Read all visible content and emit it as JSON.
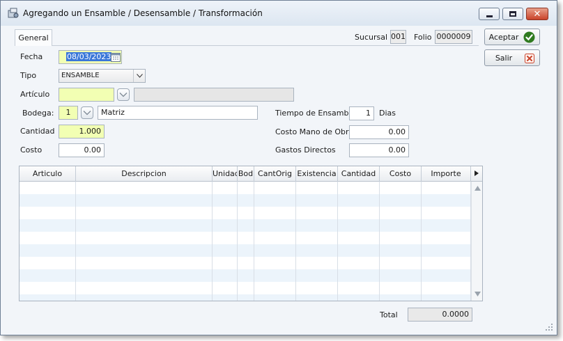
{
  "window": {
    "title": "Agregando un Ensamble / Desensamble / Transformación"
  },
  "tabs": [
    {
      "label": "General"
    }
  ],
  "header": {
    "sucursal_label": "Sucursal",
    "sucursal_value": "001",
    "folio_label": "Folio",
    "folio_value": "0000009"
  },
  "buttons": {
    "aceptar": "Aceptar",
    "salir": "Salir"
  },
  "form": {
    "fecha_label": "Fecha",
    "fecha_value": "08/03/2023",
    "tipo_label": "Tipo",
    "tipo_value": "ENSAMBLE",
    "articulo_label": "Artículo",
    "articulo_value": "",
    "articulo_desc": "",
    "bodega_label": "Bodega:",
    "bodega_value": "1",
    "bodega_name": "Matriz",
    "cantidad_label": "Cantidad",
    "cantidad_value": "1.000",
    "costo_label": "Costo",
    "costo_value": "0.00",
    "tiempo_label": "Tiempo de Ensamble",
    "tiempo_value": "1",
    "tiempo_unit": "Dias",
    "mano_obra_label": "Costo Mano de Obra",
    "mano_obra_value": "0.00",
    "gastos_label": "Gastos Directos",
    "gastos_value": "0.00"
  },
  "grid": {
    "columns": [
      "Articulo",
      "Descripcion",
      "Unidad",
      "Bod",
      "CantOrig",
      "Existencia",
      "Cantidad",
      "Costo",
      "Importe"
    ],
    "rows": []
  },
  "footer": {
    "total_label": "Total",
    "total_value": "0.0000"
  },
  "colors": {
    "required_field": "#f2ffb3",
    "row_alt": "#ecf4fb",
    "accept_icon": "#2f7a1f",
    "close_icon": "#c9432a"
  }
}
